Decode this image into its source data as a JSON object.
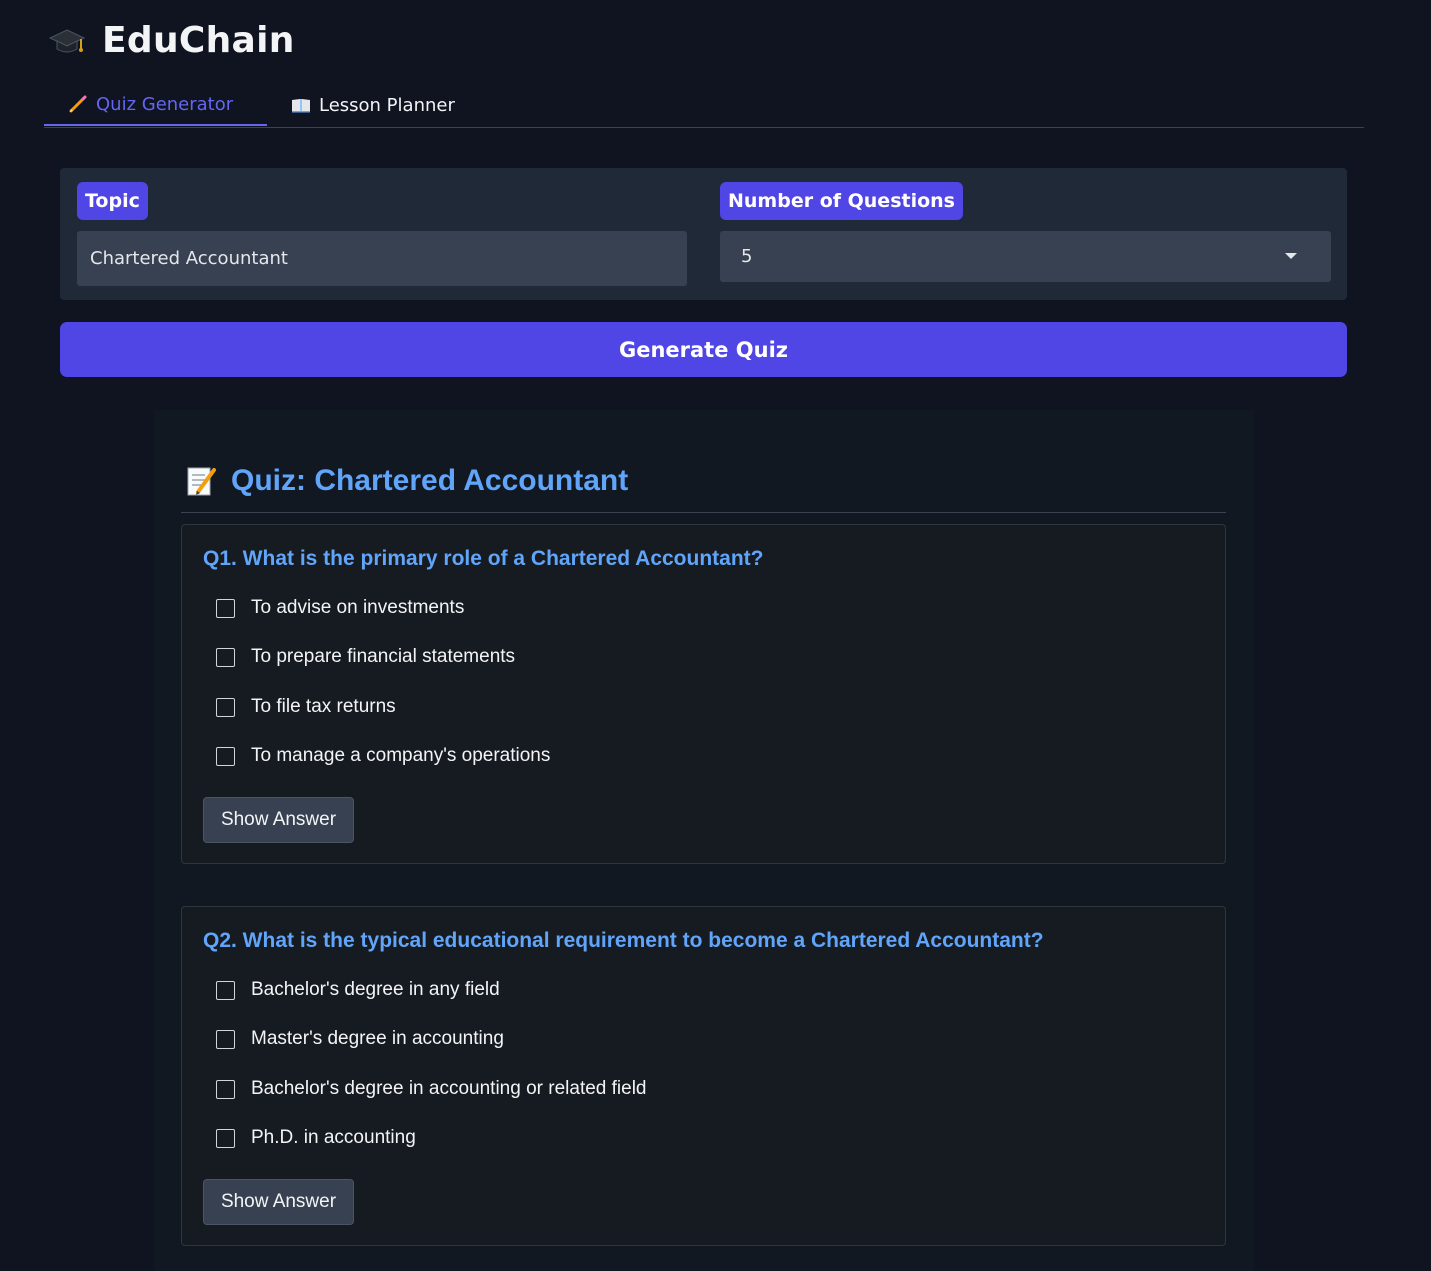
{
  "app": {
    "title": "EduChain",
    "logo_icon": "graduation-cap-icon"
  },
  "tabs": [
    {
      "label": "Quiz Generator",
      "icon": "pencil-icon",
      "active": true
    },
    {
      "label": "Lesson Planner",
      "icon": "open-book-icon",
      "active": false
    }
  ],
  "form": {
    "topic_label": "Topic",
    "topic_value": "Chartered Accountant",
    "num_label": "Number of Questions",
    "num_value": "5",
    "generate_label": "Generate Quiz"
  },
  "quiz": {
    "title": "Quiz: Chartered Accountant",
    "title_icon": "memo-icon",
    "questions": [
      {
        "text": "Q1. What is the primary role of a Chartered Accountant?",
        "options": [
          "To advise on investments",
          "To prepare financial statements",
          "To file tax returns",
          "To manage a company's operations"
        ],
        "show_answer_label": "Show Answer"
      },
      {
        "text": "Q2. What is the typical educational requirement to become a Chartered Accountant?",
        "options": [
          "Bachelor's degree in any field",
          "Master's degree in accounting",
          "Bachelor's degree in accounting or related field",
          "Ph.D. in accounting"
        ],
        "show_answer_label": "Show Answer"
      }
    ]
  },
  "colors": {
    "background": "#0f1420",
    "accent": "#4f46e5",
    "active_tab": "#6366f1",
    "question_text": "#60a5fa",
    "panel": "#1f2937",
    "input": "#374151"
  }
}
